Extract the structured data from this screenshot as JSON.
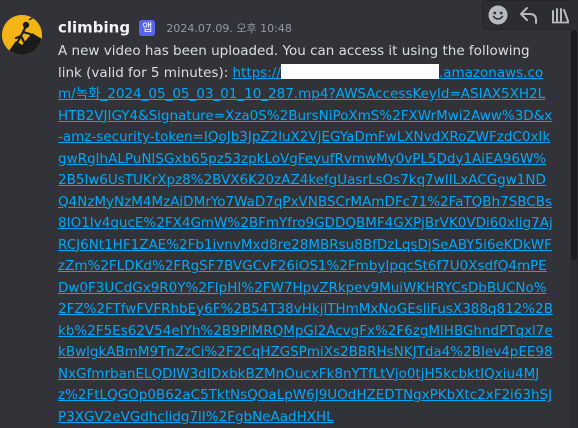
{
  "message": {
    "username": "climbing",
    "badge": "앱",
    "timestamp": "2024.07.09. 오후 10:48",
    "text": "A new video has been uploaded. You can access it using the following link (valid for 5 minutes): ",
    "link_start": "https://",
    "link_rest": ".amazonaws.com/녹화_2024_05_05_03_01_10_287.mp4?AWSAccessKeyId=ASIAX5XH2LHTB2VJIGY4&Signature=Xza0S%2BursNiPoXmS%2FXWrMwi2Aww%3D&x-amz-security-token=IQoJb3JpZ2luX2VjEGYaDmFwLXNvdXRoZWFzdC0xIkgwRgIhALPuNISGxb65pz53zpkLoVgFeyufRvmwMy0vPL5Ddy1AiEA96W%2B5lw6UsTUKrXpz8%2BVX6K20zAZ4kefgUasrLsOs7kq7wIILxACGgw1NDQ4NzMyNzM4MzAiDMrYo7WaD7qPxVNBSCrMAmDFc71%2FaTQBh7SBCBs8IO1Iv4qucE%2FX4GmW%2BFmYfro9GDDQBMF4GXPjBrVK0VDi60xIig7AjRCJ6Nt1HF1ZAE%2Fb1ivnvMxd8re28MBRsu8BfDzLqsDjSeABY5i6eKDkWFzZm%2FLDKd%2FRgSF7BVGCvF26iOS1%2FmbyIpqcSt6f7U0XsdfQ4mPEDw0F3UCdGx9R0Y%2FIpHI%2FW7HpvZRkpev9MuiWKHRYCsDbBUCNo%2FZ%2FTfwFVFRhbEy6F%2B54T38vHkjlTHmMxNoGEsliFusX388q812%2Bkb%2F5Es62V54eIYh%2B9PlMRQMpGl2AcvgFx%2F6zgMlHBGhndPTqxl7ekBwlgkABmM9TnZzCi%2F2CqHZGSPmiXs2BBRHsNKJTda4%2BIev4pEE98NxGfmrbanELQDlW3dIDxbkBZMnOucxFk8nYTfLtVjo0tjH5kcbktIQxiu4MJz%2FtLQGOp0B62aC5TktNsQOaLpW6J9UOdHZEDTNgxPKbXtc2xF2i63hSJP3XGV2eVGdhclidg7lI%2FgbNeAadHXHL"
  },
  "toolbar": {
    "buttons": [
      "add-reaction-icon",
      "reply-icon",
      "more-actions-icon"
    ]
  },
  "colors": {
    "background": "#313338",
    "link": "#00a8fc",
    "badge": "#5865f2",
    "avatar_bg": "#f3b515"
  }
}
